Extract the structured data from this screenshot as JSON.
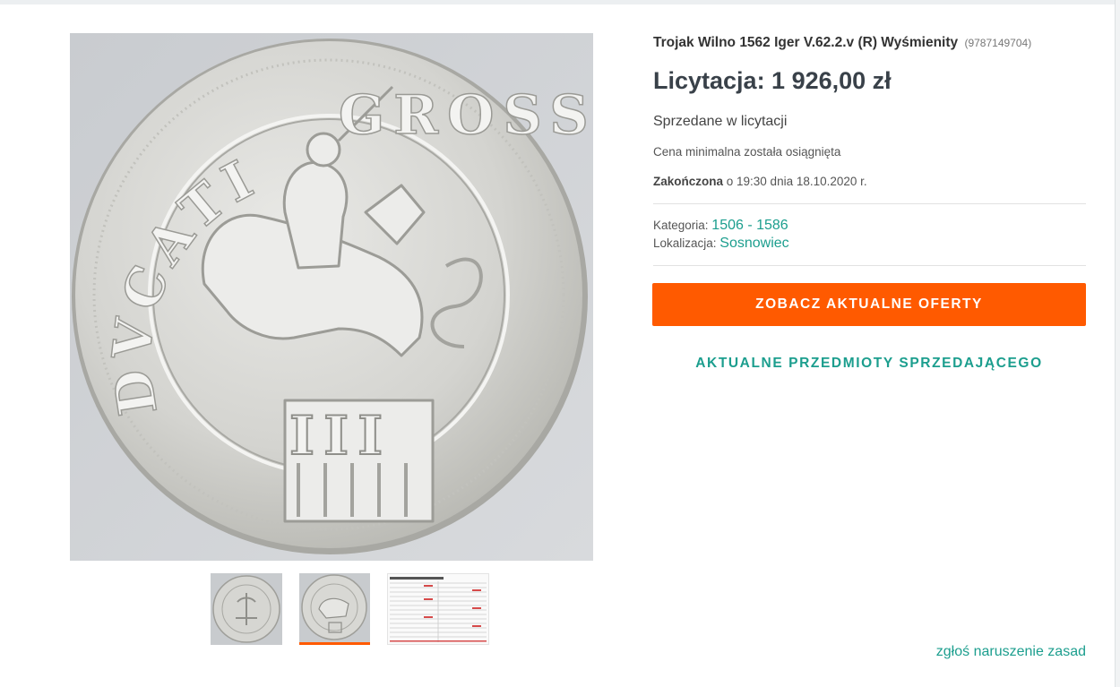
{
  "listing": {
    "title": "Trojak Wilno 1562 Iger V.62.2.v (R) Wyśmienity",
    "item_id": "(9787149704)",
    "price_label": "Licytacja: 1 926,00 zł",
    "sold_status": "Sprzedane w licytacji",
    "min_price_status": "Cena minimalna została osiągnięta",
    "ended_label": "Zakończona",
    "ended_text": " o 19:30 dnia 18.10.2020 r.",
    "category_label": "Kategoria: ",
    "category_value": "1506 - 1586",
    "location_label": "Lokalizacja: ",
    "location_value": "Sosnowiec"
  },
  "actions": {
    "primary_button": "ZOBACZ AKTUALNE OFERTY",
    "seller_items_link": "AKTUALNE PRZEDMIOTY SPRZEDAJĄCEGO",
    "report_link": "zgłoś naruszenie zasad"
  },
  "coin_legend": {
    "obverse_top": "GROSS",
    "obverse_left": "DVCATI",
    "denomination": "III"
  },
  "gallery": {
    "selected_index": 1,
    "thumbnails": [
      "coin-reverse-photo",
      "coin-obverse-photo",
      "catalog-table-photo"
    ]
  },
  "colors": {
    "accent_orange": "#ff5a00",
    "link_teal": "#1c9e8e",
    "price_text": "#394149"
  }
}
